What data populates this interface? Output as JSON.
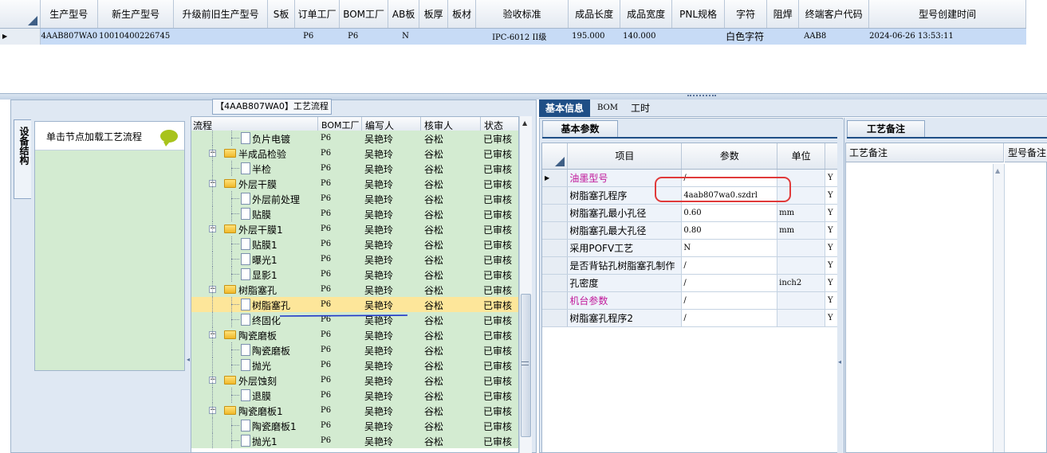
{
  "top_grid": {
    "headers": [
      "生产型号",
      "新生产型号",
      "升级前旧生产型号",
      "S板",
      "订单工厂",
      "BOM工厂",
      "AB板",
      "板厚",
      "板材",
      "验收标准",
      "成品长度",
      "成品宽度",
      "PNL规格",
      "字符",
      "阻焊",
      "终端客户代码",
      "型号创建时间"
    ],
    "row": [
      "4AAB807WA0",
      "10010400226745",
      "",
      "",
      "P6",
      "P6",
      "N",
      "",
      "",
      "IPC-6012 II级",
      "195.000",
      "140.000",
      "",
      "白色字符",
      "",
      "AAB8",
      "2024-06-26 13:53:11"
    ]
  },
  "left": {
    "vertical_tab": "设备结构",
    "panel_hint": "单击节点加载工艺流程",
    "flow_title": "【4AAB807WA0】工艺流程",
    "tree_headers": [
      "流程",
      "BOM工厂",
      "编写人",
      "核审人",
      "状态"
    ],
    "tree_rows": [
      {
        "name": "负片电镀",
        "type": "doc",
        "level": 1,
        "bom": "P6",
        "writer": "吴艳玲",
        "reviewer": "谷松",
        "status": "已审核"
      },
      {
        "name": "半成品检验",
        "type": "folder",
        "level": 0,
        "bom": "P6",
        "writer": "吴艳玲",
        "reviewer": "谷松",
        "status": "已审核"
      },
      {
        "name": "半检",
        "type": "doc",
        "level": 1,
        "bom": "P6",
        "writer": "吴艳玲",
        "reviewer": "谷松",
        "status": "已审核"
      },
      {
        "name": "外层干膜",
        "type": "folder",
        "level": 0,
        "bom": "P6",
        "writer": "吴艳玲",
        "reviewer": "谷松",
        "status": "已审核"
      },
      {
        "name": "外层前处理",
        "type": "doc",
        "level": 1,
        "bom": "P6",
        "writer": "吴艳玲",
        "reviewer": "谷松",
        "status": "已审核"
      },
      {
        "name": "贴膜",
        "type": "doc",
        "level": 1,
        "bom": "P6",
        "writer": "吴艳玲",
        "reviewer": "谷松",
        "status": "已审核"
      },
      {
        "name": "外层干膜1",
        "type": "folder",
        "level": 0,
        "bom": "P6",
        "writer": "吴艳玲",
        "reviewer": "谷松",
        "status": "已审核"
      },
      {
        "name": "贴膜1",
        "type": "doc",
        "level": 1,
        "bom": "P6",
        "writer": "吴艳玲",
        "reviewer": "谷松",
        "status": "已审核"
      },
      {
        "name": "曝光1",
        "type": "doc",
        "level": 1,
        "bom": "P6",
        "writer": "吴艳玲",
        "reviewer": "谷松",
        "status": "已审核"
      },
      {
        "name": "显影1",
        "type": "doc",
        "level": 1,
        "bom": "P6",
        "writer": "吴艳玲",
        "reviewer": "谷松",
        "status": "已审核"
      },
      {
        "name": "树脂塞孔",
        "type": "folder",
        "level": 0,
        "bom": "P6",
        "writer": "吴艳玲",
        "reviewer": "谷松",
        "status": "已审核"
      },
      {
        "name": "树脂塞孔",
        "type": "doc",
        "level": 1,
        "bom": "P6",
        "writer": "吴艳玲",
        "reviewer": "谷松",
        "status": "已审核",
        "selected": true
      },
      {
        "name": "终固化",
        "type": "doc",
        "level": 1,
        "bom": "P6",
        "writer": "吴艳玲",
        "reviewer": "谷松",
        "status": "已审核"
      },
      {
        "name": "陶瓷磨板",
        "type": "folder",
        "level": 0,
        "bom": "P6",
        "writer": "吴艳玲",
        "reviewer": "谷松",
        "status": "已审核"
      },
      {
        "name": "陶瓷磨板",
        "type": "doc",
        "level": 1,
        "bom": "P6",
        "writer": "吴艳玲",
        "reviewer": "谷松",
        "status": "已审核"
      },
      {
        "name": "抛光",
        "type": "doc",
        "level": 1,
        "bom": "P6",
        "writer": "吴艳玲",
        "reviewer": "谷松",
        "status": "已审核"
      },
      {
        "name": "外层蚀刻",
        "type": "folder",
        "level": 0,
        "bom": "P6",
        "writer": "吴艳玲",
        "reviewer": "谷松",
        "status": "已审核"
      },
      {
        "name": "退膜",
        "type": "doc",
        "level": 1,
        "bom": "P6",
        "writer": "吴艳玲",
        "reviewer": "谷松",
        "status": "已审核"
      },
      {
        "name": "陶瓷磨板1",
        "type": "folder",
        "level": 0,
        "bom": "P6",
        "writer": "吴艳玲",
        "reviewer": "谷松",
        "status": "已审核"
      },
      {
        "name": "陶瓷磨板1",
        "type": "doc",
        "level": 1,
        "bom": "P6",
        "writer": "吴艳玲",
        "reviewer": "谷松",
        "status": "已审核"
      },
      {
        "name": "抛光1",
        "type": "doc",
        "level": 1,
        "bom": "P6",
        "writer": "吴艳玲",
        "reviewer": "谷松",
        "status": "已审核"
      }
    ]
  },
  "right": {
    "tabs": [
      "基本信息",
      "BOM",
      "工时"
    ],
    "basic_params_tab": "基本参数",
    "param_headers": [
      "项目",
      "参数",
      "单位"
    ],
    "params": [
      {
        "item": "油墨型号",
        "value": "/",
        "unit": "",
        "flag": "Y",
        "pink": true
      },
      {
        "item": "树脂塞孔程序",
        "value": "4aab807wa0.szdrl",
        "unit": "",
        "flag": "Y"
      },
      {
        "item": "树脂塞孔最小孔径",
        "value": "0.60",
        "unit": "mm",
        "flag": "Y"
      },
      {
        "item": "树脂塞孔最大孔径",
        "value": "0.80",
        "unit": "mm",
        "flag": "Y"
      },
      {
        "item": "采用POFV工艺",
        "value": "N",
        "unit": "",
        "flag": "Y"
      },
      {
        "item": "是否背钻孔树脂塞孔制作",
        "value": "/",
        "unit": "",
        "flag": "Y"
      },
      {
        "item": "孔密度",
        "value": "/",
        "unit": "inch2",
        "flag": "Y"
      },
      {
        "item": "机台参数",
        "value": "/",
        "unit": "",
        "flag": "Y",
        "pink": true
      },
      {
        "item": "树脂塞孔程序2",
        "value": "/",
        "unit": "",
        "flag": "Y"
      }
    ],
    "notes_tab": "工艺备注",
    "notes_headers": [
      "工艺备注",
      "型号备注"
    ]
  },
  "colors": {
    "highlight_box": "#e03a3a",
    "underline": "#1e35c9",
    "selected_row": "#fde69a",
    "tree_bg": "#d3ebd1",
    "active_tab": "#1f4f86",
    "pink_text": "#c0189a"
  }
}
